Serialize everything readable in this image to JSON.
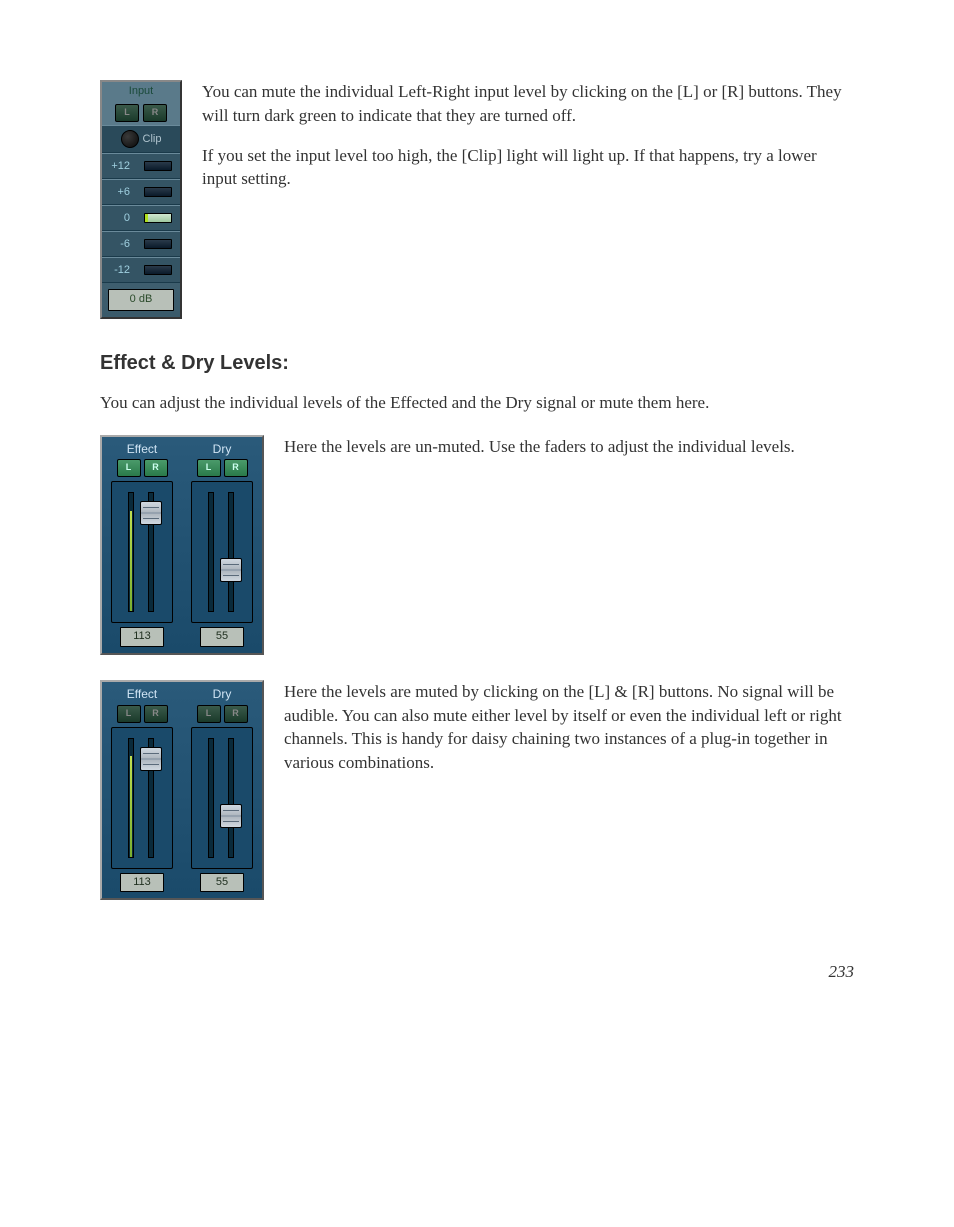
{
  "input_panel": {
    "title": "Input",
    "btn_l": "L",
    "btn_r": "R",
    "clip_label": "Clip",
    "scale": [
      "+12",
      "+6",
      "0",
      "-6",
      "-12"
    ],
    "db_readout": "0 dB"
  },
  "para1": "You can mute the individual Left-Right input level by clicking on the [L] or [R] buttons. They will turn dark green to indicate that they are turned off.",
  "para2": "If you set the input level too high, the [Clip] light will light up. If that happens, try a lower input setting.",
  "heading1": "Effect & Dry Levels:",
  "para3": "You can adjust the individual levels of the Effected and the Dry signal or mute them here.",
  "fx_panel": {
    "effect_label": "Effect",
    "dry_label": "Dry",
    "btn_l": "L",
    "btn_r": "R",
    "effect_value": "113",
    "dry_value": "55"
  },
  "para4": "Here the levels are un-muted. Use the faders to adjust the individual levels.",
  "para5": "Here the levels are muted by clicking on the [L] & [R] buttons. No signal will be audible. You can also mute either level by itself or even the individual left or right channels. This is handy for daisy chaining two instances of a plug-in together in various combinations.",
  "page_number": "233"
}
